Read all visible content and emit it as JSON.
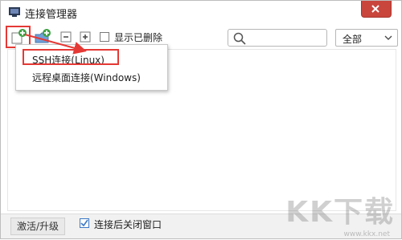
{
  "window": {
    "title": "连接管理器"
  },
  "toolbar": {
    "show_deleted_label": "显示已删除",
    "filter_value": "全部"
  },
  "dropdown_menu": {
    "items": [
      "SSH连接(Linux)",
      "远程桌面连接(Windows)"
    ]
  },
  "footer": {
    "upgrade_label": "激活/升级",
    "close_after_connect_label": "连接后关闭窗口",
    "close_after_connect_checked": true
  },
  "watermark": {
    "text": "KK下载",
    "url": "www.kkx.net"
  },
  "colors": {
    "accent_red": "#e53935",
    "close_button": "#c9463d",
    "checkbox_blue": "#3c78c5"
  },
  "icons": [
    "app-icon",
    "new-connection-icon",
    "add-folder-icon",
    "minus-icon",
    "expand-icon",
    "search-icon",
    "chevron-down-icon",
    "close-icon",
    "checkmark-icon"
  ]
}
